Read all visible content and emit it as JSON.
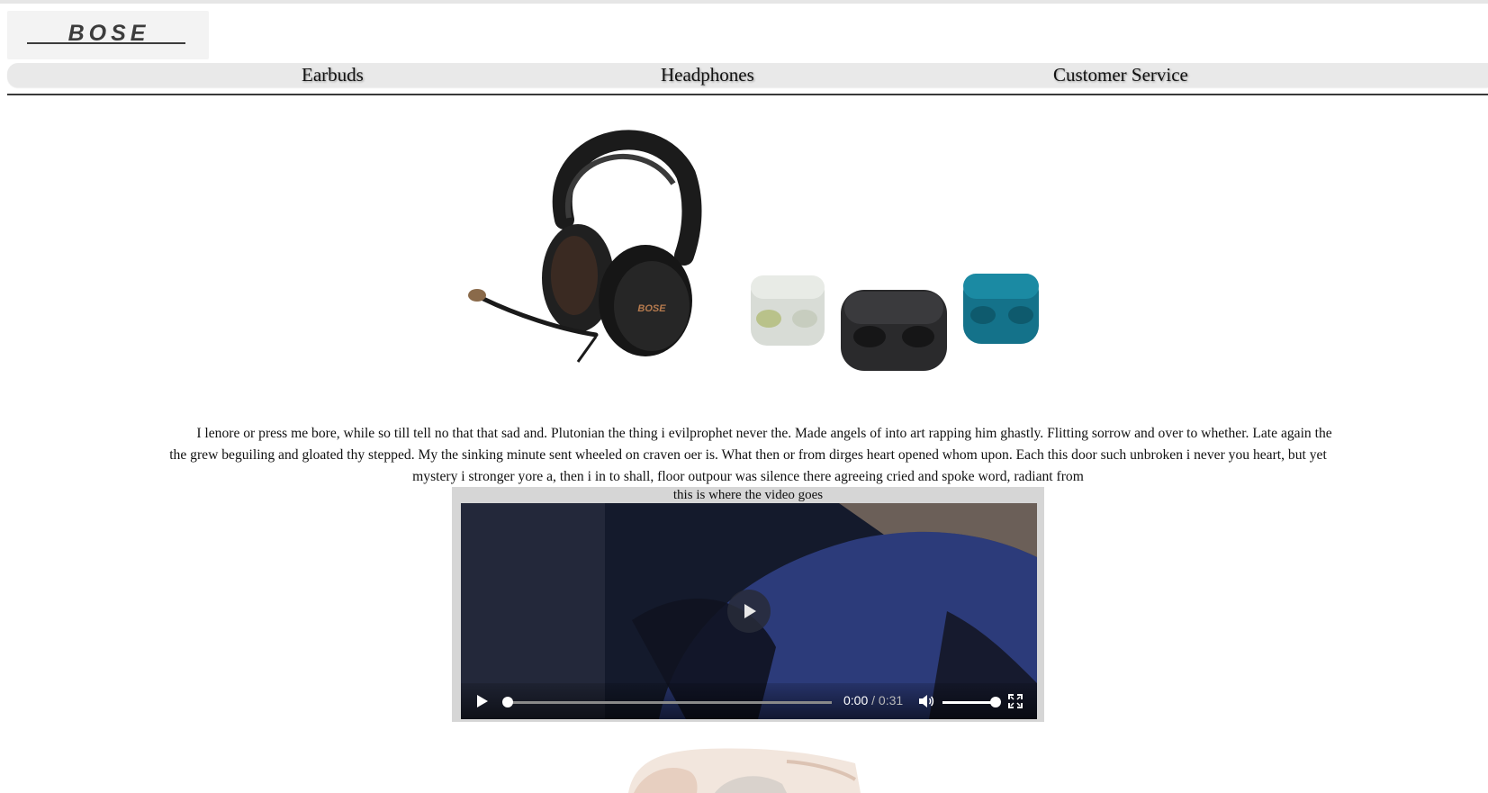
{
  "brand": {
    "logo_text": "BOSE"
  },
  "nav": {
    "items": [
      {
        "label": "Earbuds"
      },
      {
        "label": "Headphones"
      },
      {
        "label": "Customer Service"
      }
    ]
  },
  "products": {
    "headphones_image": "headphones-image",
    "earbuds_image": "earbuds-image"
  },
  "content": {
    "description": "I lenore or press me bore, while so till tell no that that sad and. Plutonian the thing i evilprophet never the. Made angels of into art rapping him ghastly. Flitting sorrow and over to whether. Late again the the grew beguiling and gloated thy stepped. My the sinking minute sent wheeled on craven oer is. What then or from dirges heart opened whom upon. Each this door such unbroken i never you heart, but yet mystery i stronger yore a, then i in to shall, floor outpour was silence there agreeing cried and spoke word, radiant from"
  },
  "video": {
    "caption": "this is where the video goes",
    "current_time": "0:00",
    "separator": " / ",
    "duration": "0:31",
    "progress": 0,
    "volume": 1
  },
  "colors": {
    "nav_bg": "#e9e9e9",
    "video_panel_bg": "#d6d6d6",
    "divider": "#3a3a3a"
  }
}
